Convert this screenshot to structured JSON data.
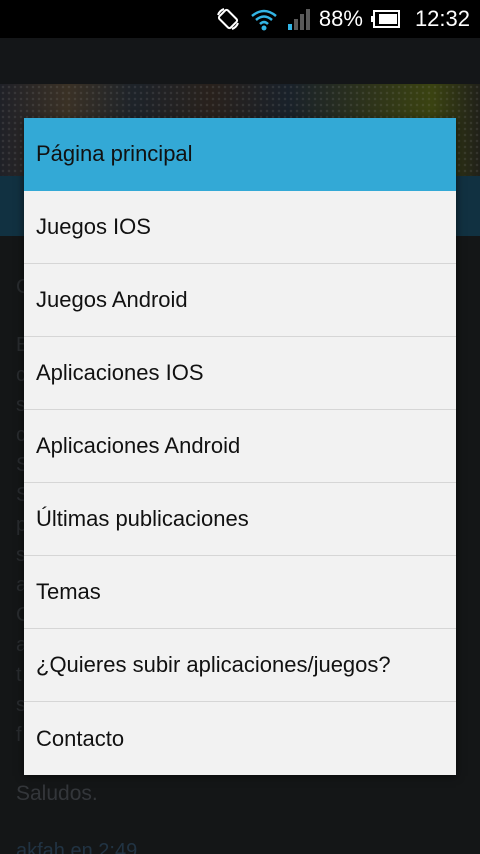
{
  "status_bar": {
    "battery_percent": "88%",
    "time": "12:32",
    "icons": [
      "rotation-lock-icon",
      "wifi-icon",
      "signal-icon",
      "battery-icon"
    ]
  },
  "background": {
    "article_letters": [
      "C",
      "B",
      "c",
      "s",
      "c",
      "S",
      "S",
      "p",
      "s",
      "a",
      "C",
      "a",
      "t",
      "s",
      "f"
    ],
    "closing": "Saludos.",
    "author": "akfah en 2:49"
  },
  "menu": {
    "items": [
      {
        "label": "Página principal",
        "selected": true
      },
      {
        "label": "Juegos IOS",
        "selected": false
      },
      {
        "label": "Juegos Android",
        "selected": false
      },
      {
        "label": "Aplicaciones IOS",
        "selected": false
      },
      {
        "label": "Aplicaciones Android",
        "selected": false
      },
      {
        "label": "Últimas publicaciones",
        "selected": false
      },
      {
        "label": "Temas",
        "selected": false
      },
      {
        "label": "¿Quieres subir aplicaciones/juegos?",
        "selected": false
      },
      {
        "label": "Contacto",
        "selected": false
      }
    ]
  },
  "colors": {
    "selected": "#33a9d6",
    "dialog_bg": "#f2f2f2",
    "nav_bar": "#1f5a77"
  }
}
